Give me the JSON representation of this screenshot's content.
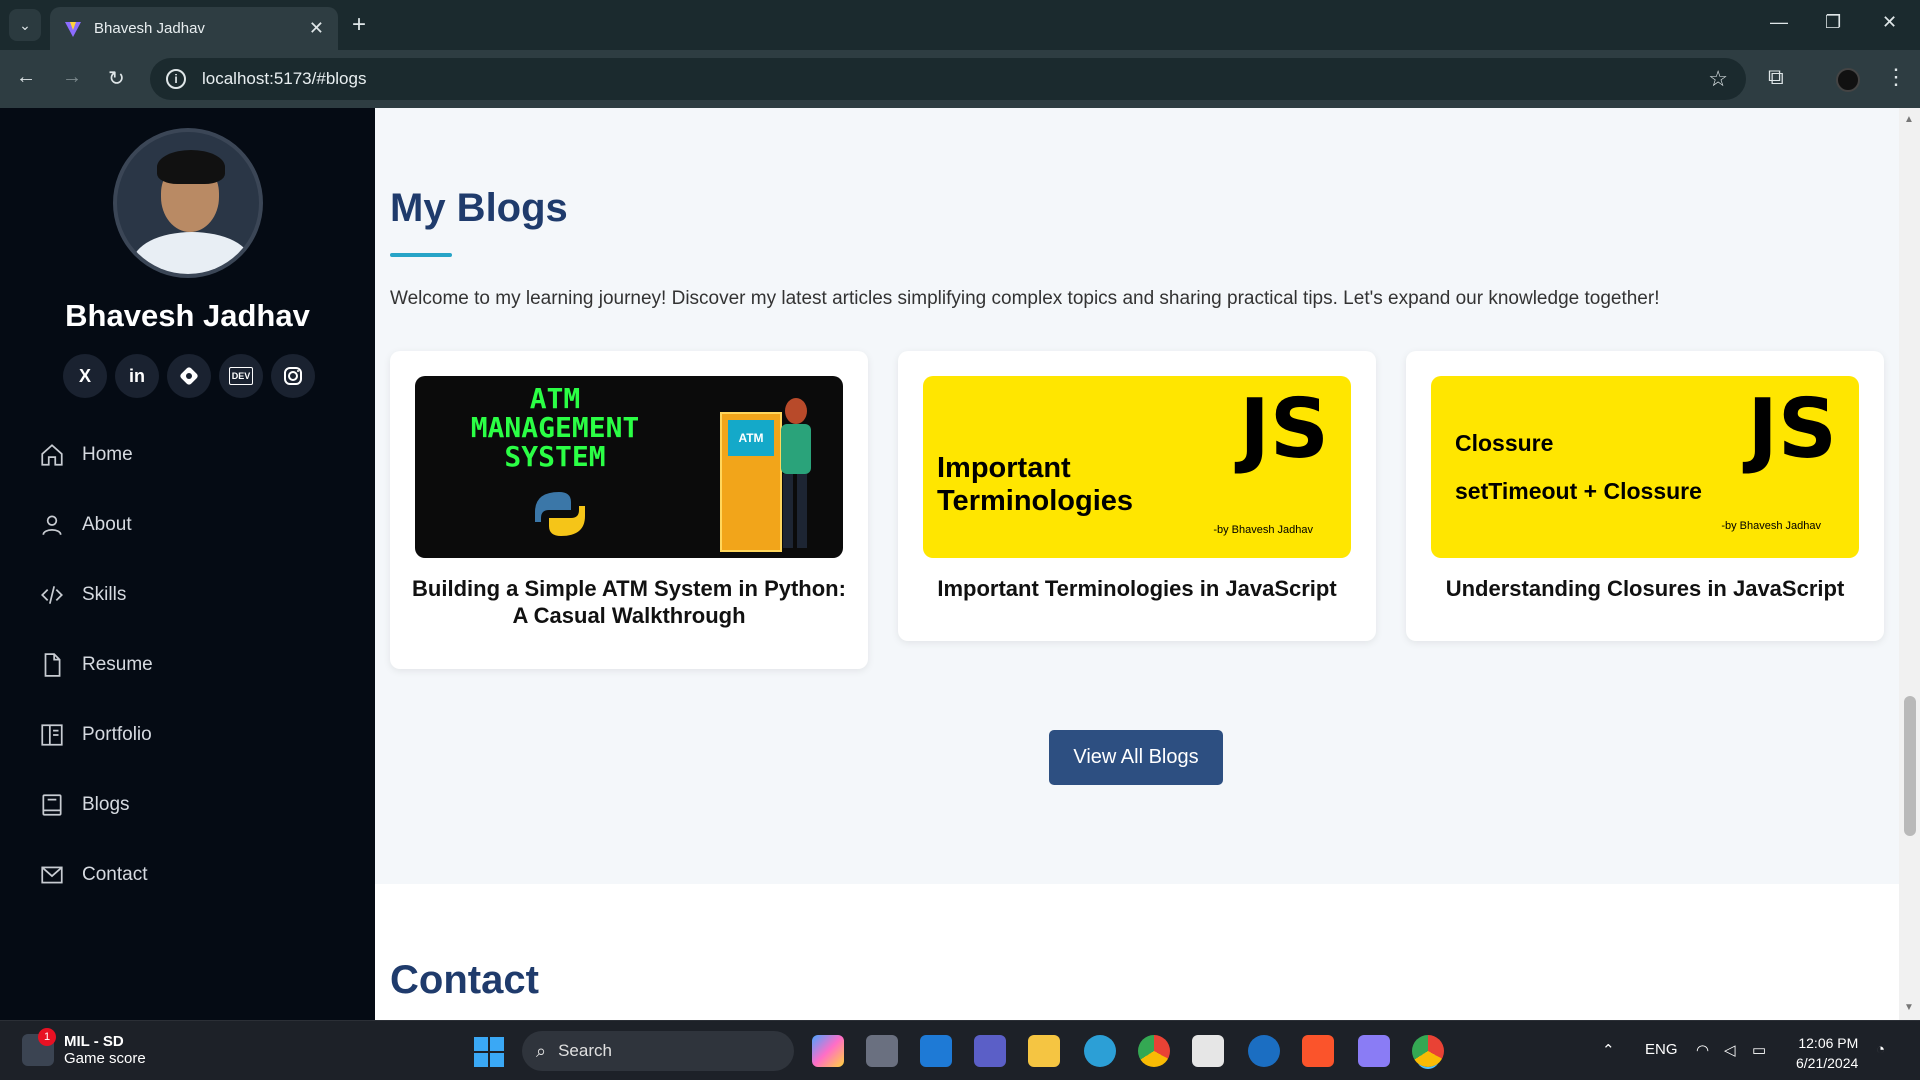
{
  "browser": {
    "tab_title": "Bhavesh Jadhav",
    "url": "localhost:5173/#blogs"
  },
  "sidebar": {
    "name": "Bhavesh Jadhav",
    "socials": [
      "X",
      "in",
      "DEV"
    ],
    "nav": [
      {
        "label": "Home",
        "icon": "home-icon"
      },
      {
        "label": "About",
        "icon": "user-icon"
      },
      {
        "label": "Skills",
        "icon": "code-icon"
      },
      {
        "label": "Resume",
        "icon": "file-icon"
      },
      {
        "label": "Portfolio",
        "icon": "portfolio-icon"
      },
      {
        "label": "Blogs",
        "icon": "book-icon"
      },
      {
        "label": "Contact",
        "icon": "mail-icon"
      }
    ]
  },
  "blogs": {
    "heading": "My Blogs",
    "intro": "Welcome to my learning journey! Discover my latest articles simplifying complex topics and sharing practical tips. Let's expand our knowledge together!",
    "cards": [
      {
        "title": "Building a Simple ATM System in Python: A Casual Walkthrough",
        "thumb_lines": [
          "ATM",
          "MANAGEMENT",
          "SYSTEM"
        ],
        "thumb_tag": "ATM"
      },
      {
        "title": "Important Terminologies in JavaScript",
        "thumb_big": "JS",
        "thumb_lines": [
          "Important",
          "Terminologies"
        ],
        "thumb_by": "-by Bhavesh Jadhav"
      },
      {
        "title": "Understanding Closures in JavaScript",
        "thumb_big": "JS",
        "thumb_lines": [
          "Clossure",
          "setTimeout + Clossure"
        ],
        "thumb_by": "-by Bhavesh Jadhav"
      }
    ],
    "view_all": "View All Blogs"
  },
  "contact": {
    "heading": "Contact"
  },
  "taskbar": {
    "game_title": "MIL - SD",
    "game_sub": "Game score",
    "game_badge": "1",
    "search": "Search",
    "lang": "ENG",
    "time": "12:06 PM",
    "date": "6/21/2024"
  },
  "colors": {
    "sidebar_bg": "#050b14",
    "heading": "#1f3b6c",
    "accent": "#27a4c7",
    "button": "#2d4f81",
    "yellow_thumb": "#ffe600"
  }
}
